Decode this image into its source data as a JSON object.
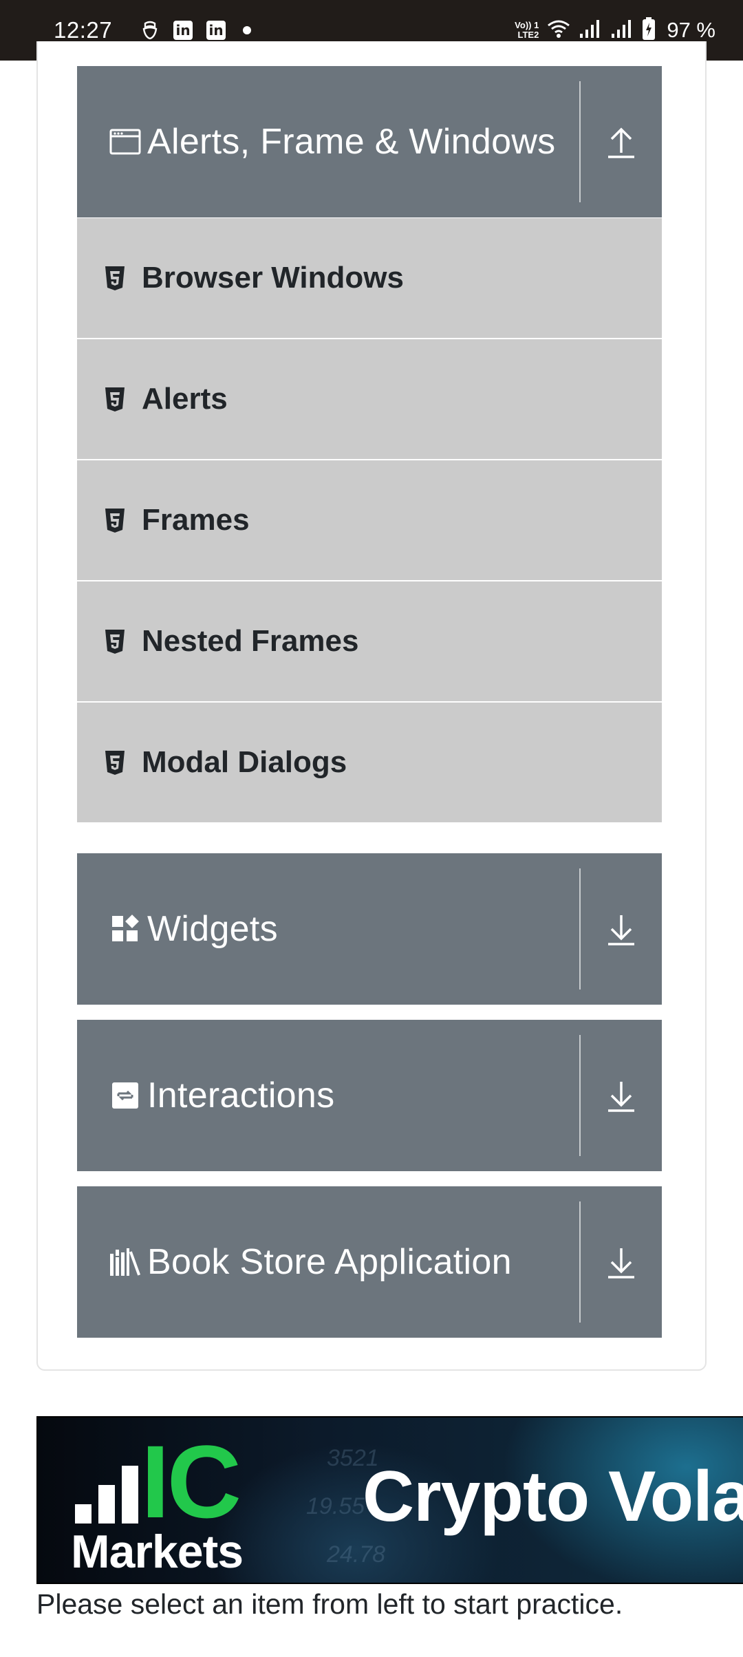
{
  "status_bar": {
    "time": "12:27",
    "network_label_1": "Vo)) 1",
    "network_label_2": "LTE2",
    "battery": "97 %",
    "left_icons": [
      "hand-icon",
      "linkedin-icon",
      "linkedin-icon",
      "dot-icon"
    ],
    "right_icons": [
      "wifi-icon",
      "signal-icon",
      "signal-icon",
      "battery-icon"
    ]
  },
  "sidebar": {
    "groups": [
      {
        "title": "Alerts, Frame & Windows",
        "icon": "window-icon",
        "toggle": "collapse-up-icon",
        "expanded": true,
        "items": [
          {
            "label": "Browser Windows",
            "icon": "html5-icon"
          },
          {
            "label": "Alerts",
            "icon": "html5-icon"
          },
          {
            "label": "Frames",
            "icon": "html5-icon"
          },
          {
            "label": "Nested Frames",
            "icon": "html5-icon"
          },
          {
            "label": "Modal Dialogs",
            "icon": "html5-icon"
          }
        ]
      },
      {
        "title": "Widgets",
        "icon": "widgets-icon",
        "toggle": "expand-down-icon",
        "expanded": false
      },
      {
        "title": "Interactions",
        "icon": "interactions-icon",
        "toggle": "expand-down-icon",
        "expanded": false
      },
      {
        "title": "Book Store Application",
        "icon": "books-icon",
        "toggle": "expand-down-icon",
        "expanded": false
      }
    ]
  },
  "ad": {
    "brand_ic": "IC",
    "brand_markets": "Markets",
    "headline": "Crypto Vola",
    "bg_numbers": [
      "3521",
      "19.55",
      "24.78"
    ]
  },
  "footer": {
    "text": "Please select an item from left to start practice."
  },
  "colors": {
    "status_bar": "#211c19",
    "group_header": "#6c757d",
    "menu_item": "#cbcbcb",
    "ad_green": "#22c84b"
  }
}
